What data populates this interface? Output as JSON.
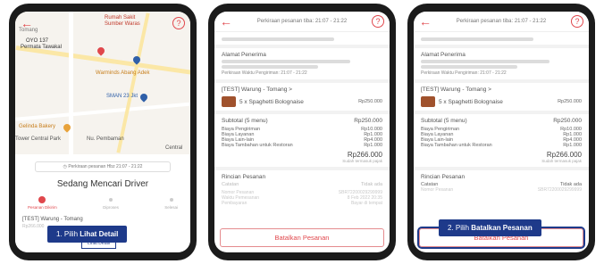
{
  "phone1": {
    "map_labels": [
      "Rumah Sakit",
      "Sumber Waras",
      "Tomang",
      "OYO 137",
      "Permata Tawakal",
      "Warminds Abang Adek",
      "SMAN 23 Jkt",
      "Gelinda Bakery",
      "Tower Central Park",
      "Nu. Pembaman",
      "Central"
    ],
    "order_strip": "Perkiraan pesanan Hbz 21:07 - 21:22",
    "status_title": "Sedang Mencari Driver",
    "steps": [
      "Pesanan Dikirim",
      "Diproses",
      "Selesai"
    ],
    "store_line": "[TEST] Warung - Tomang",
    "price_hint": "Rp266.000",
    "detail_button": "Lihat Detail"
  },
  "phone2": {
    "top_title": "Perkiraan pesanan tiba: 21:07 - 21:22",
    "address_header": "Alamat Penerima",
    "estimate_text": "Perkiraan Waktu Pengiriman: 21:07 - 21:22",
    "store_header": "[TEST] Warung - Tomang >",
    "item_name": "5 x Spaghetti Bolognaise",
    "item_price": "Rp250.000",
    "subtotal_label": "Subtotal (5 menu)",
    "subtotal_value": "Rp250.000",
    "fees": [
      {
        "label": "Biaya Pengiriman",
        "value": "Rp10.000"
      },
      {
        "label": "Biaya Layanan",
        "value": "Rp1.000"
      },
      {
        "label": "Biaya Lain-lain",
        "value": "Rp4.000"
      },
      {
        "label": "Biaya Tambahan untuk Restoran",
        "value": "Rp1.000"
      }
    ],
    "total": "Rp266.000",
    "tax_note": "Sudah termasuk pajak",
    "summary_header": "Rincian Pesanan",
    "summary_rows": [
      {
        "label": "Catatan",
        "value": "Tidak ada"
      },
      {
        "label": "Nomor Pesanan",
        "value": "SBR72200029299999"
      },
      {
        "label": "Waktu Pemesanan",
        "value": "8 Feb 2022 20:35"
      },
      {
        "label": "Pembayaran",
        "value": "Bayar di tempat"
      }
    ],
    "cancel_button": "Batalkan Pesanan"
  },
  "phone3": {
    "top_title": "Perkiraan pesanan tiba: 21:07 - 21:22",
    "address_header": "Alamat Penerima",
    "estimate_text": "Perkiraan Waktu Pengiriman: 21:07 - 21:22",
    "store_header": "[TEST] Warung - Tomang >",
    "item_name": "5 x Spaghetti Bolognaise",
    "item_price": "Rp250.000",
    "subtotal_label": "Subtotal (5 menu)",
    "subtotal_value": "Rp250.000",
    "fees": [
      {
        "label": "Biaya Pengiriman",
        "value": "Rp10.000"
      },
      {
        "label": "Biaya Layanan",
        "value": "Rp1.000"
      },
      {
        "label": "Biaya Lain-lain",
        "value": "Rp4.000"
      },
      {
        "label": "Biaya Tambahan untuk Restoran",
        "value": "Rp1.000"
      }
    ],
    "total": "Rp266.000",
    "tax_note": "Sudah termasuk pajak",
    "summary_header": "Rincian Pesanan",
    "summary_rows": [
      {
        "label": "Catatan",
        "value": "Tidak ada"
      },
      {
        "label": "Nomor Pesanan",
        "value": "SBR72200029299999"
      }
    ],
    "cancel_button": "Batalkan Pesanan"
  },
  "callouts": {
    "step1_prefix": "1. Pilih ",
    "step1_bold": "Lihat Detail",
    "step2_prefix": "2. Pilih ",
    "step2_bold": "Batalkan Pesanan"
  },
  "colors": {
    "accent": "#e0474c",
    "callout": "#1e3a8a"
  }
}
